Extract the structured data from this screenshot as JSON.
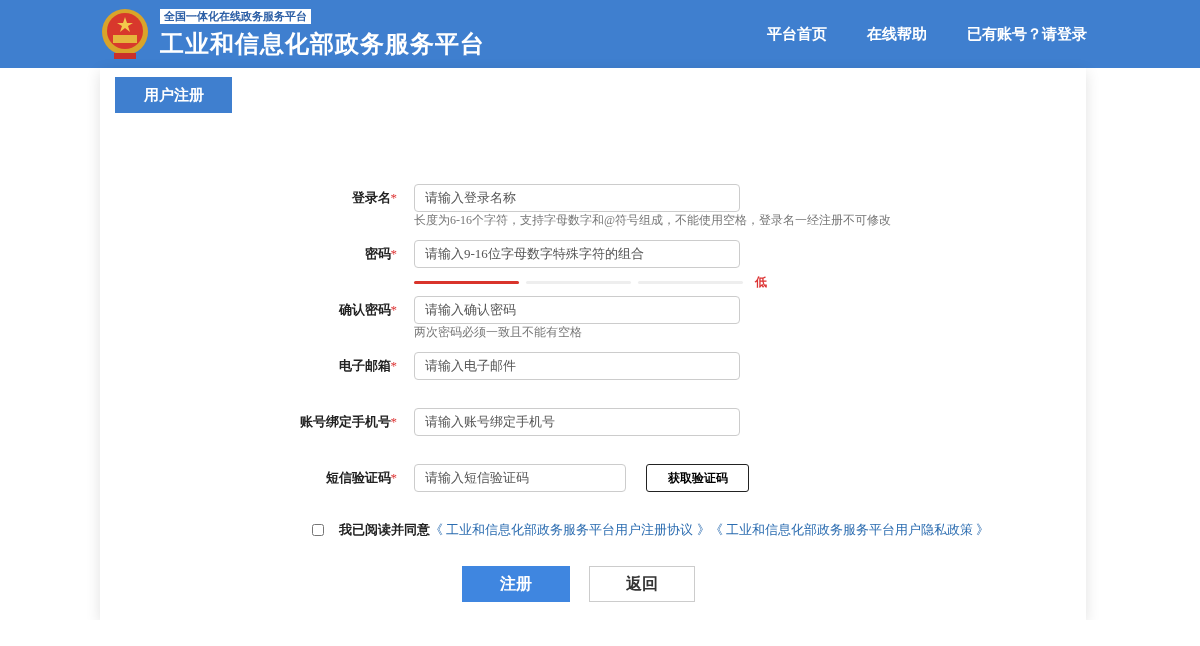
{
  "header": {
    "badge": "全国一体化在线政务服务平台",
    "title": "工业和信息化部政务服务平台",
    "nav": [
      {
        "label": "平台首页"
      },
      {
        "label": "在线帮助"
      },
      {
        "label": "已有账号？请登录"
      }
    ]
  },
  "tab": {
    "label": "用户注册",
    "selected": true
  },
  "fields": [
    {
      "kind": "text",
      "label": "登录名",
      "mark": "*",
      "placeholder": "请输入登录名称",
      "hint": "长度为6-16个字符，支持字母数字和@符号组成，不能使用空格，登录名一经注册不可修改"
    },
    {
      "kind": "password",
      "label": "密码",
      "mark": "*",
      "placeholder": "请输入9-16位字母数字特殊字符的组合",
      "strength": {
        "level": 0.32,
        "label": "低"
      }
    },
    {
      "kind": "password",
      "label": "确认密码",
      "mark": "*",
      "placeholder": "请输入确认密码",
      "hint": "两次密码必须一致且不能有空格"
    },
    {
      "kind": "text",
      "label": "电子邮箱",
      "mark": "*",
      "placeholder": "请输入电子邮件"
    },
    {
      "kind": "text",
      "label": "账号绑定手机号",
      "mark": "*",
      "placeholder": "请输入账号绑定手机号"
    },
    {
      "kind": "code",
      "label": "短信验证码",
      "mark": "*",
      "placeholder": "请输入短信验证码",
      "button": "获取验证码"
    }
  ],
  "agreement": {
    "checked": false,
    "text": "我已阅读并同意",
    "links": [
      "《 工业和信息化部政务服务平台用户注册协议 》",
      "《 工业和信息化部政务服务平台用户隐私政策 》"
    ]
  },
  "buttons": [
    {
      "kind": "primary",
      "label": "注册"
    },
    {
      "kind": "secondary",
      "label": "返回"
    }
  ]
}
